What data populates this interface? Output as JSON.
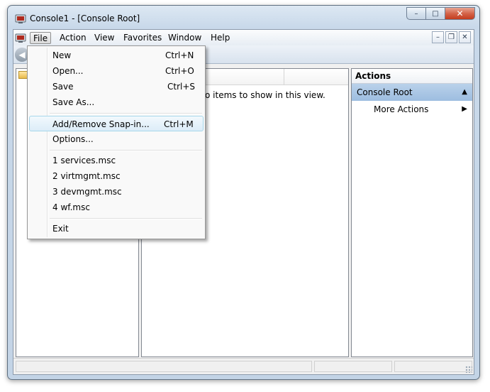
{
  "window": {
    "title": "Console1 - [Console Root]",
    "minimize_glyph": "–",
    "maximize_glyph": "□",
    "close_glyph": "✕"
  },
  "menubar": {
    "items": [
      "File",
      "Action",
      "View",
      "Favorites",
      "Window",
      "Help"
    ],
    "mdi_minimize_glyph": "–",
    "mdi_restore_glyph": "❐",
    "mdi_close_glyph": "✕"
  },
  "toolbar": {
    "back_glyph": "◀"
  },
  "result_pane": {
    "empty_text": "There are no items to show in this view."
  },
  "actions_pane": {
    "header": "Actions",
    "group": "Console Root",
    "group_arrow": "▲",
    "more_actions": "More Actions",
    "more_arrow": "▶"
  },
  "file_menu": {
    "new": {
      "label": "New",
      "shortcut": "Ctrl+N"
    },
    "open": {
      "label": "Open...",
      "shortcut": "Ctrl+O"
    },
    "save": {
      "label": "Save",
      "shortcut": "Ctrl+S"
    },
    "save_as": {
      "label": "Save As...",
      "shortcut": ""
    },
    "add_remove": {
      "label": "Add/Remove Snap-in...",
      "shortcut": "Ctrl+M"
    },
    "options": {
      "label": "Options...",
      "shortcut": ""
    },
    "recent": [
      "1 services.msc",
      "2 virtmgmt.msc",
      "3 devmgmt.msc",
      "4 wf.msc"
    ],
    "exit": {
      "label": "Exit",
      "shortcut": ""
    }
  },
  "icons": {
    "app": "mmc-console-icon",
    "folder": "folder-icon"
  },
  "colors": {
    "selection_blue": "#dcecf8",
    "actions_group_blue": "#9dbde0"
  }
}
